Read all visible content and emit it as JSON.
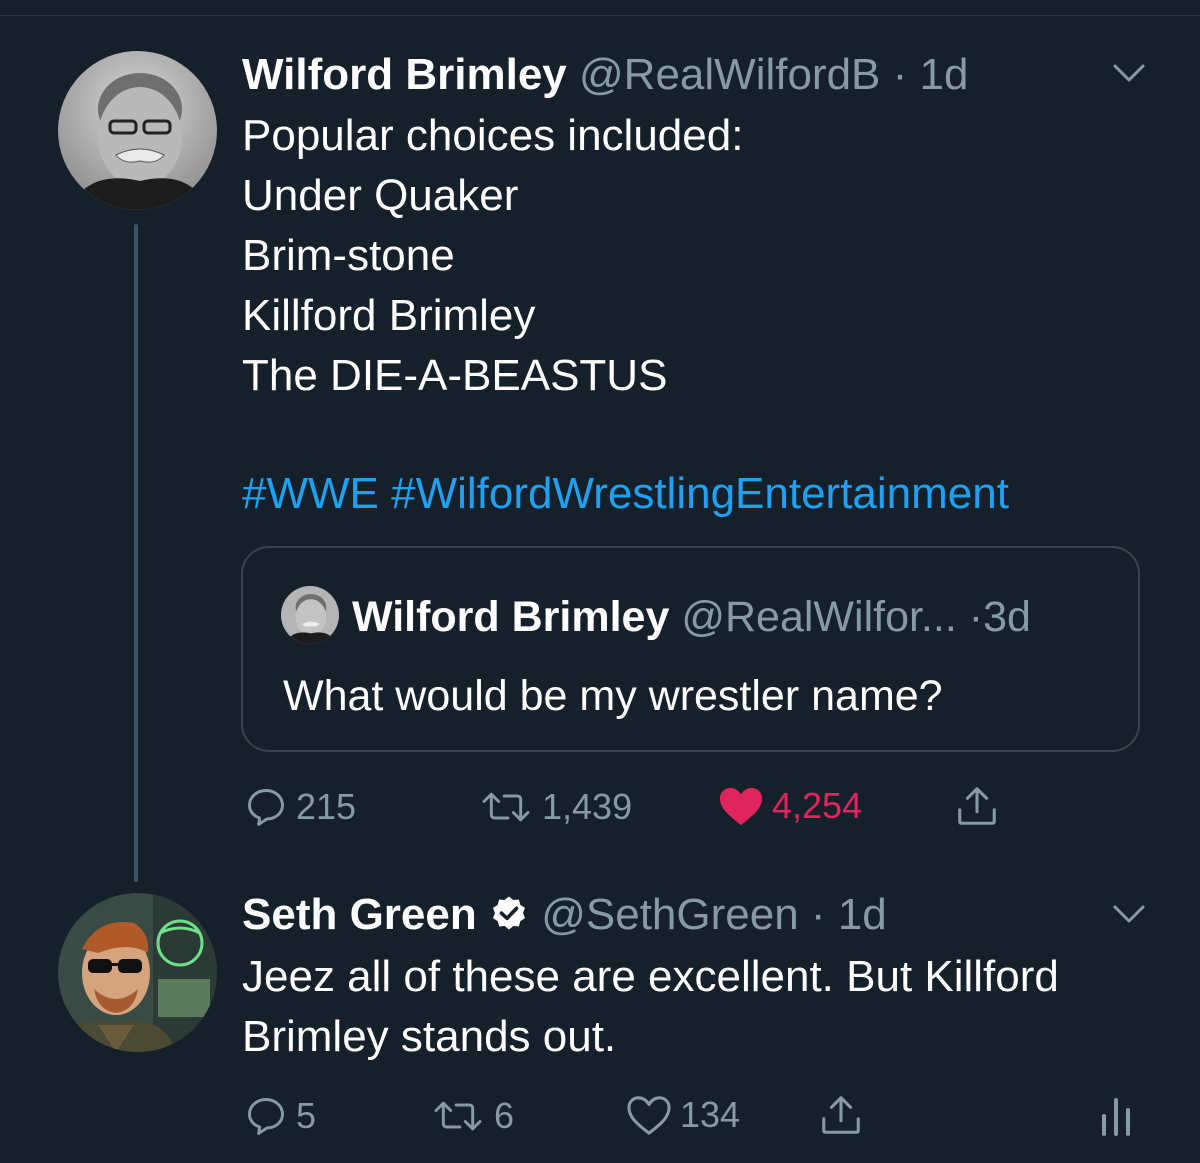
{
  "colors": {
    "background": "#15202b",
    "text": "#ffffff",
    "muted": "#8899a6",
    "link": "#1da1f2",
    "like": "#e0245e",
    "border": "#38444d"
  },
  "tweet1": {
    "name": "Wilford Brimley",
    "handle": "@RealWilfordB",
    "separator": "·",
    "time": "1d",
    "lines": [
      "Popular choices included:",
      "Under Quaker",
      "Brim-stone",
      "Killford Brimley",
      "The DIE-A-BEASTUS"
    ],
    "hashtags": "#WWE #WilfordWrestlingEntertainment",
    "quote": {
      "name": "Wilford Brimley",
      "handle": "@RealWilfor...",
      "separator": "·",
      "time": "3d",
      "text": "What would be my wrestler name?"
    },
    "actions": {
      "replies": "215",
      "retweets": "1,439",
      "likes": "4,254"
    },
    "liked": true,
    "icons": [
      "reply-icon",
      "retweet-icon",
      "heart-filled-icon",
      "share-icon",
      "chevron-down-icon"
    ]
  },
  "tweet2": {
    "name": "Seth Green",
    "verified": true,
    "handle": "@SethGreen",
    "separator": "·",
    "time": "1d",
    "lines": [
      "Jeez all of these are excellent. But Killford",
      "Brimley stands out."
    ],
    "actions": {
      "replies": "5",
      "retweets": "6",
      "likes": "134"
    },
    "liked": false,
    "icons": [
      "reply-icon",
      "retweet-icon",
      "heart-outline-icon",
      "share-icon",
      "analytics-icon",
      "chevron-down-icon",
      "verified-badge-icon"
    ]
  }
}
